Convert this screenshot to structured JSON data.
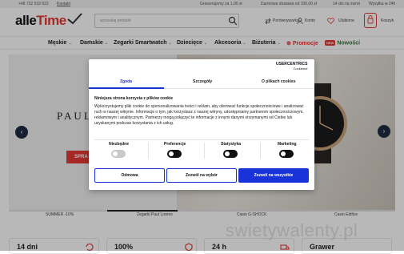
{
  "topbar": {
    "phone": "+48 732 533 522",
    "contact": "Kontakt",
    "engraving": "Grawerujemy za 1,00 zł",
    "free_shipping": "Darmowa dostawa od 100,00 zł",
    "returns": "14 dni na zwrot",
    "delivery": "Wysyłka w 24h"
  },
  "header": {
    "logo_main": "alle",
    "logo_accent": "Time",
    "search_placeholder": "wyszukaj produkt",
    "compare": "Porównywarka",
    "account": "Konto",
    "favorites": "Ulubione",
    "cart": "Koszyk"
  },
  "nav": {
    "items": [
      "Męskie",
      "Damskie",
      "Zegarki Smartwatch",
      "Dziecięce",
      "Akcesoria",
      "Biżuteria"
    ],
    "promo": "Promocje",
    "new_badge": "NEW",
    "new_label": "Nowości"
  },
  "hero": {
    "brand_text": "PAUL",
    "button": "SPRA",
    "thumbs": [
      "SUMMER -10%",
      "Zegarki Paul Lorens",
      "Casio G-SHOCK",
      "Casio Edifice"
    ]
  },
  "features": [
    "14 dni",
    "100%",
    "24 h",
    "Grawer"
  ],
  "watermark": "swietywalenty.pl",
  "cookie": {
    "logo_line1": "USERCENTRICS",
    "logo_line2": "Cookiebot",
    "tabs": [
      "Zgoda",
      "Szczegóły",
      "O plikach cookies"
    ],
    "heading": "Niniejsza strona korzysta z plików cookie",
    "text_lines": [
      "Wykorzystujemy pliki cookie do spersonalizowania treści i reklam, aby oferować funkcje społecznościowe i analizować",
      "ruch w naszej witrynie. Informacje o tym, jak korzystasz z naszej witryny, udostępniamy partnerom społecznościowym,",
      "reklamowym i analitycznym. Partnerzy mogą połączyć te informacje z innymi danymi otrzymanymi od Ciebie lub",
      "uzyskanymi podczas korzystania z ich usług."
    ],
    "toggles": [
      {
        "label": "Niezbędne",
        "on": false
      },
      {
        "label": "Preferencje",
        "on": true
      },
      {
        "label": "Statystyka",
        "on": true
      },
      {
        "label": "Marketing",
        "on": true
      }
    ],
    "btn_reject": "Odmowa",
    "btn_selection": "Zezwól na wybór",
    "btn_all": "Zezwól na wszystkie"
  },
  "colors": {
    "accent": "#e53935",
    "cookie_blue": "#1a33d8",
    "nav_dark": "#1f2a44"
  }
}
